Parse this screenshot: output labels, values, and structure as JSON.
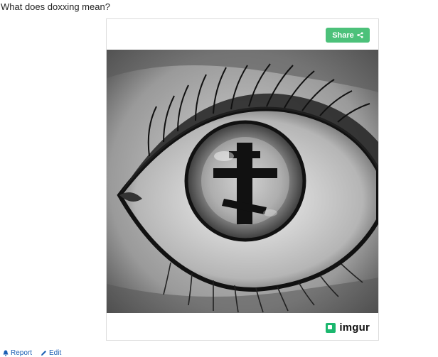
{
  "question": {
    "title": "What does doxxing mean?"
  },
  "embed": {
    "share_label": "Share",
    "brand": "imgur",
    "image_icon": "eye-with-cross-image"
  },
  "footer": {
    "report_label": "Report",
    "edit_label": "Edit"
  },
  "colors": {
    "share_green": "#4cc17a",
    "imgur_green": "#1bb76e",
    "link_blue": "#1a5fb4"
  }
}
